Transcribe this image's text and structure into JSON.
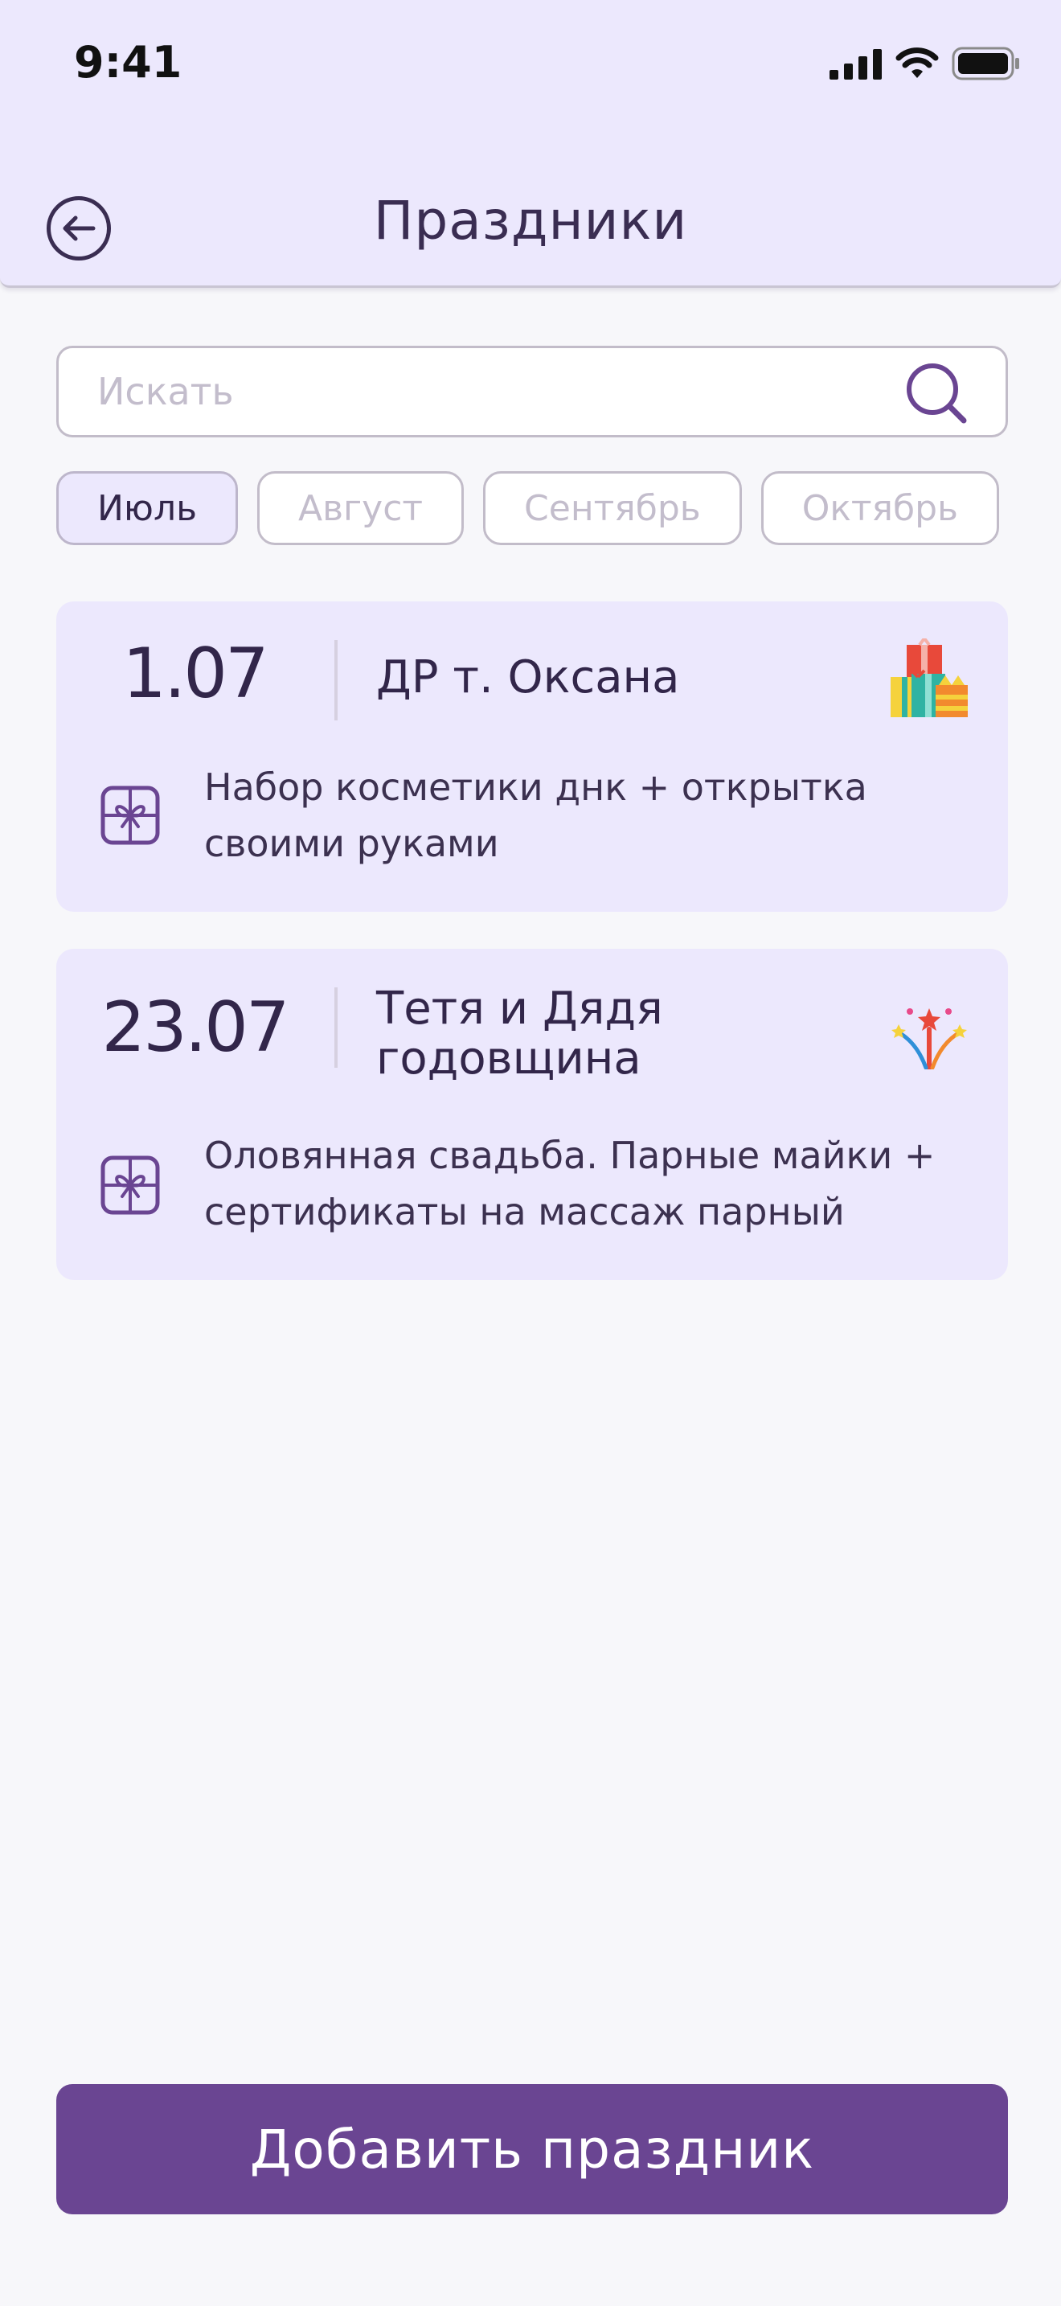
{
  "status": {
    "time": "9:41"
  },
  "header": {
    "title": "Праздники"
  },
  "search": {
    "placeholder": "Искать"
  },
  "months": [
    "Июль",
    "Август",
    "Сентябрь",
    "Октябрь"
  ],
  "active_month": "Июль",
  "holidays": [
    {
      "date": "1.07",
      "name": "ДР т. Оксана",
      "emoji_icon": "gifts-icon",
      "gift": "Набор косметики днк + открытка своими руками"
    },
    {
      "date": "23.07",
      "name": "Тетя и Дядя годовщина",
      "emoji_icon": "fireworks-icon",
      "gift": "Оловянная свадьба. Парные майки + сертификаты на массаж парный"
    }
  ],
  "add_button": {
    "label": "Добавить праздник"
  },
  "colors": {
    "header_bg": "#ece8fd",
    "card_bg": "#ece8fd",
    "accent": "#6a4592",
    "text": "#32264a"
  }
}
